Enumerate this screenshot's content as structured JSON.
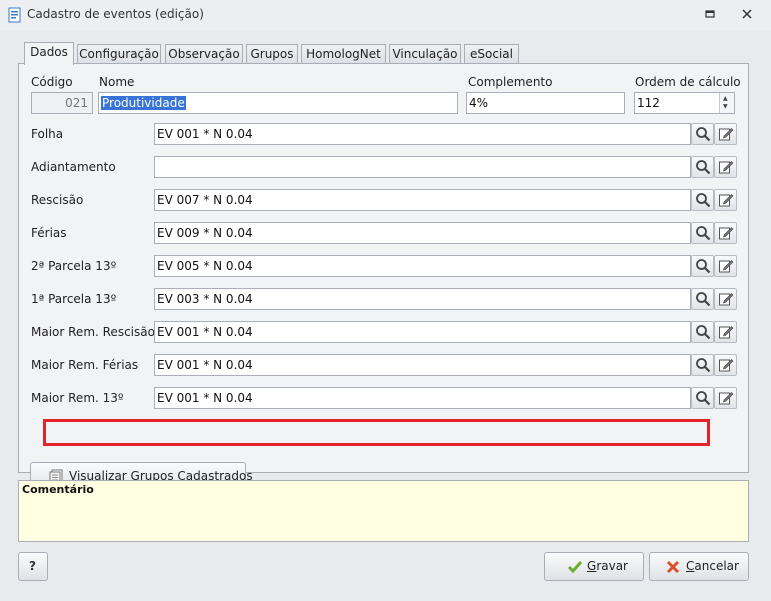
{
  "window": {
    "title": "Cadastro de eventos (edição)"
  },
  "tabs": [
    "Dados",
    "Configuração",
    "Observação",
    "Grupos",
    "HomologNet",
    "Vinculação",
    "eSocial"
  ],
  "header_fields": {
    "codigo": {
      "label": "Código",
      "value": "021"
    },
    "nome": {
      "label": "Nome",
      "value": "Produtividade"
    },
    "complemento": {
      "label": "Complemento",
      "value": "4%"
    },
    "ordem": {
      "label": "Ordem de cálculo",
      "value": "112"
    }
  },
  "formula_rows": [
    {
      "label": "Folha",
      "value": "EV 001 * N 0.04"
    },
    {
      "label": "Adiantamento",
      "value": ""
    },
    {
      "label": "Rescisão",
      "value": "EV 007 * N 0.04"
    },
    {
      "label": "Férias",
      "value": "EV 009 * N 0.04"
    },
    {
      "label": "2ª Parcela 13º",
      "value": "EV 005 * N 0.04"
    },
    {
      "label": "1ª Parcela 13º",
      "value": "EV 003 * N 0.04"
    },
    {
      "label": "Maior Rem. Rescisão",
      "value": "EV 001 * N 0.04"
    },
    {
      "label": "Maior Rem. Férias",
      "value": "EV 001 * N 0.04"
    },
    {
      "label": "Maior Rem. 13º",
      "value": "EV 001 * N 0.04"
    }
  ],
  "buttons": {
    "visualizar": "Visualizar Grupos Cadastrados",
    "help": "?",
    "gravar_first": "G",
    "gravar_rest": "ravar",
    "cancelar_first": "C",
    "cancelar_rest": "ancelar"
  },
  "comment": {
    "label": "Comentário"
  },
  "colors": {
    "highlight": "#e2232a",
    "selection": "#3874d8",
    "comment_bg": "#ffffe1"
  },
  "icons": [
    "search-icon",
    "edit-icon",
    "list-icon",
    "check-icon",
    "close-icon",
    "help-icon"
  ]
}
